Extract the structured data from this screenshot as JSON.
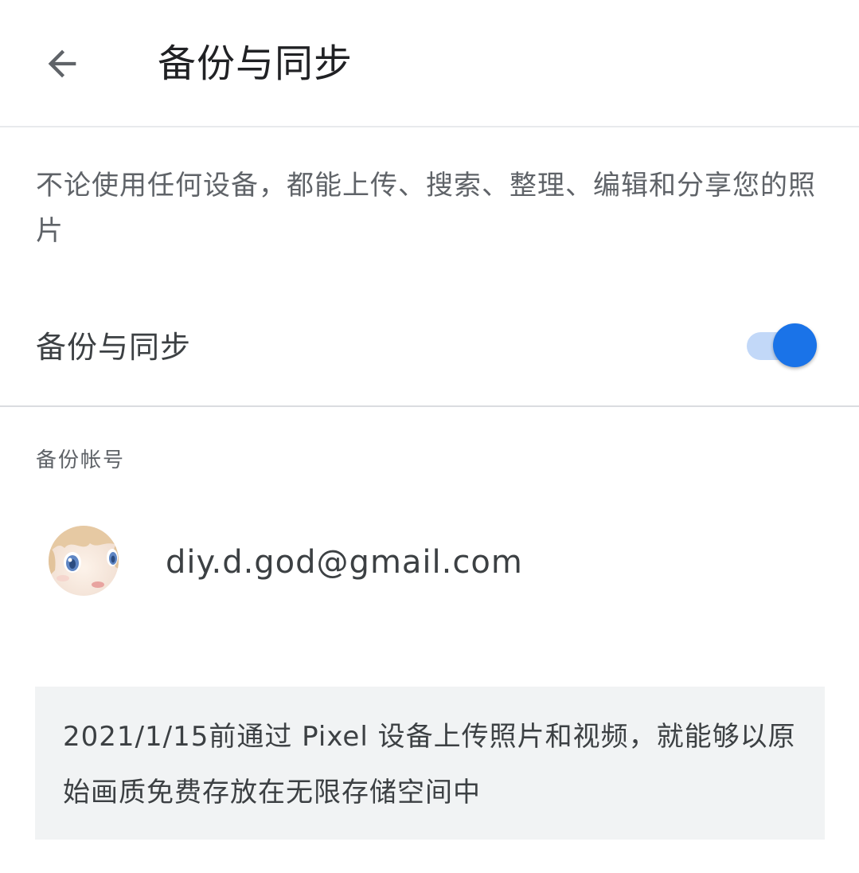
{
  "header": {
    "back_icon": "arrow-back-icon",
    "title": "备份与同步"
  },
  "description": "不论使用任何设备，都能上传、搜索、整理、编辑和分享您的照片",
  "sync": {
    "label": "备份与同步",
    "enabled": true,
    "accent_color": "#1a73e8",
    "track_color": "#c2d8f8"
  },
  "account_section": {
    "header": "备份帐号",
    "email": "diy.d.god@gmail.com",
    "avatar_icon": "anime-avatar-icon"
  },
  "info_box": {
    "text": "2021/1/15前通过 Pixel 设备上传照片和视频，就能够以原始画质免费存放在无限存储空间中",
    "background_color": "#f1f3f4"
  }
}
